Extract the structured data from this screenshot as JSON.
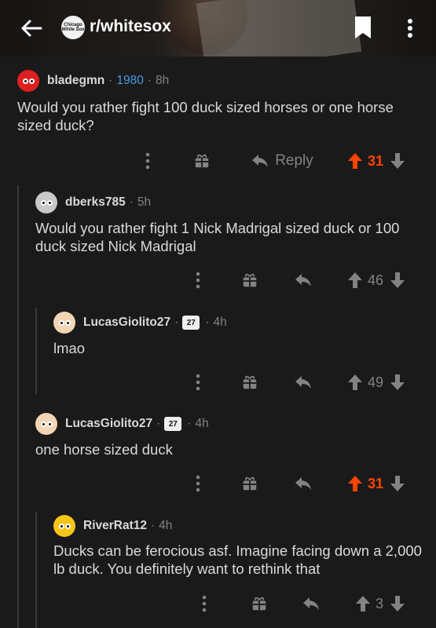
{
  "header": {
    "subreddit": "r/whitesox",
    "icon_text": "Chicago White Sox",
    "icons": {
      "back": "arrow-left-icon",
      "bookmark": "bookmark-icon",
      "more": "more-vert-icon"
    }
  },
  "colors": {
    "upvoted": "#ff4500",
    "flair": "#4a9be3",
    "muted": "#818384",
    "text": "#d7dadc"
  },
  "comments": [
    {
      "user": "bladegmn",
      "flair": "1980",
      "age": "8h",
      "text": "Would you rather fight 100 duck sized horses or one horse sized duck?",
      "reply_label": "Reply",
      "score": "31",
      "upvoted": true
    },
    {
      "user": "dberks785",
      "age": "5h",
      "text": "Would you rather fight 1 Nick Madrigal sized duck or 100 duck sized Nick Madrigal",
      "score": "46",
      "upvoted": false
    },
    {
      "user": "LucasGiolito27",
      "jersey": "27",
      "age": "4h",
      "text": "lmao",
      "score": "49",
      "upvoted": false
    },
    {
      "user": "LucasGiolito27",
      "jersey": "27",
      "age": "4h",
      "text": "one horse sized duck",
      "score": "31",
      "upvoted": true
    },
    {
      "user": "RiverRat12",
      "age": "4h",
      "text": "Ducks can be ferocious asf. Imagine facing down a 2,000 lb duck. You definitely want to rethink that",
      "score": "3",
      "upvoted": false
    }
  ]
}
